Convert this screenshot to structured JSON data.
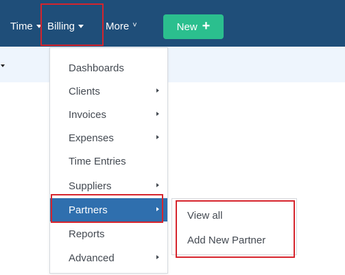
{
  "navbar": {
    "time_label": "Time",
    "billing_label": "Billing",
    "more_label": "More",
    "more_icon": "double-chevron-down-icon",
    "new_button_label": "New",
    "new_button_icon": "plus-icon",
    "background_color": "#1f4e79",
    "new_button_color": "#2bbf8e"
  },
  "billing_menu": {
    "items": [
      {
        "label": "Dashboards",
        "has_submenu": false
      },
      {
        "label": "Clients",
        "has_submenu": true
      },
      {
        "label": "Invoices",
        "has_submenu": true
      },
      {
        "label": "Expenses",
        "has_submenu": true
      },
      {
        "label": "Time Entries",
        "has_submenu": false
      },
      {
        "label": "Suppliers",
        "has_submenu": true
      },
      {
        "label": "Partners",
        "has_submenu": true,
        "active": true
      },
      {
        "label": "Reports",
        "has_submenu": false
      },
      {
        "label": "Advanced",
        "has_submenu": true
      }
    ],
    "active_color": "#2f6fae"
  },
  "partners_submenu": {
    "items": [
      {
        "label": "View all"
      },
      {
        "label": "Add New Partner"
      }
    ]
  },
  "highlight_color": "#d6242c"
}
